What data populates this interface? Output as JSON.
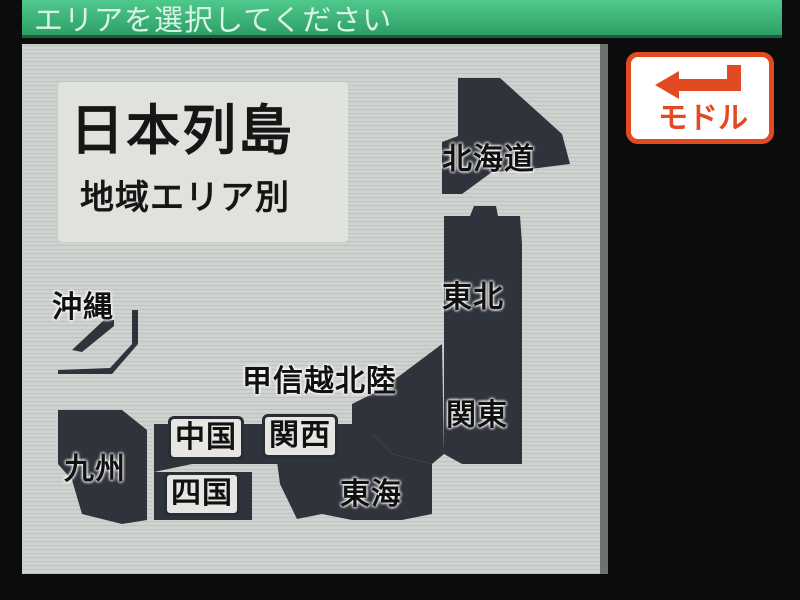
{
  "header": {
    "title": "エリアを選択してください"
  },
  "map": {
    "title_line1": "日本列島",
    "title_line2": "地域エリア別",
    "regions": {
      "hokkaido": "北海道",
      "tohoku": "東北",
      "koshinetsu_hokuriku": "甲信越北陸",
      "kanto": "関東",
      "tokai": "東海",
      "kansai": "関西",
      "chugoku": "中国",
      "shikoku": "四国",
      "kyushu": "九州",
      "okinawa": "沖縄"
    },
    "region_color": "#2f333b"
  },
  "back_button": {
    "label": "モドル",
    "accent": "#e24a22"
  },
  "icons": {
    "back": "return-arrow-icon"
  }
}
